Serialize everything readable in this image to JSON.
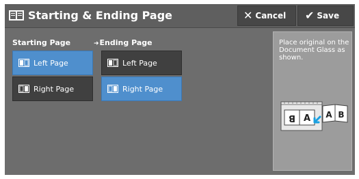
{
  "header": {
    "title": "Starting & Ending Page",
    "cancel_label": "Cancel",
    "save_label": "Save"
  },
  "starting": {
    "label": "Starting Page",
    "options": [
      {
        "label": "Left Page",
        "selected": true
      },
      {
        "label": "Right Page",
        "selected": false
      }
    ]
  },
  "ending": {
    "label": "Ending Page",
    "options": [
      {
        "label": "Left Page",
        "selected": false
      },
      {
        "label": "Right Page",
        "selected": true
      }
    ]
  },
  "panel": {
    "instruction": "Place original on the Document Glass as shown.",
    "book_letters": [
      "B",
      "A",
      "A",
      "B"
    ]
  },
  "colors": {
    "selected": "#4f8fcd",
    "button": "#404040",
    "background": "#6d6d6d",
    "accent_arrow": "#1aa0e0"
  },
  "icons": {
    "title": "book-pages-icon",
    "cancel": "x-icon",
    "save": "checkmark-icon",
    "left_page": "left-page-icon",
    "right_page": "right-page-icon"
  }
}
